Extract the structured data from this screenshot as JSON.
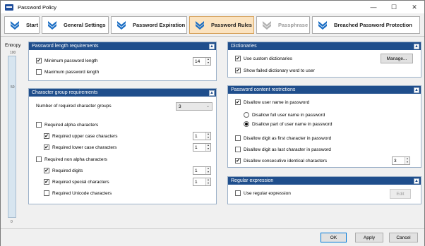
{
  "window": {
    "title": "Password Policy",
    "min_icon": "—",
    "max_icon": "☐",
    "close_icon": "✕"
  },
  "tabs": [
    {
      "label": "Start"
    },
    {
      "label": "General Settings"
    },
    {
      "label": "Password Expiration"
    },
    {
      "label": "Password Rules"
    },
    {
      "label": "Passphrase"
    },
    {
      "label": "Breached Password Protection"
    }
  ],
  "entropy": {
    "label": "Entropy",
    "tick_top": "100",
    "tick_mid": "50",
    "tick_bottom": "0"
  },
  "length_box": {
    "title": "Password length requirements",
    "min_label": "Minimum password length",
    "min_value": "14",
    "max_label": "Maximum password length"
  },
  "charset_box": {
    "title": "Character group requirements",
    "num_groups_label": "Number of required character groups",
    "num_groups_value": "3",
    "alpha_label": "Required alpha characters",
    "upper_label": "Required upper case characters",
    "upper_value": "1",
    "lower_label": "Required lower case characters",
    "lower_value": "1",
    "nonalpha_label": "Required non alpha characters",
    "digits_label": "Required digits",
    "digits_value": "1",
    "special_label": "Required special characters",
    "special_value": "1",
    "unicode_label": "Required Unicode characters"
  },
  "dict_box": {
    "title": "Dictionaries",
    "custom_label": "Use custom dictionaries",
    "manage_label": "Manage...",
    "show_failed_label": "Show failed dictionary word to user"
  },
  "content_box": {
    "title": "Password content restrictions",
    "disallow_user_label": "Disallow user name in password",
    "full_user_label": "Disallow full user name in password",
    "part_user_label": "Disallow part of user name in password",
    "digit_first_label": "Disallow digit as first character in password",
    "digit_last_label": "Disallow digit as last character in password",
    "consecutive_label": "Disallow consecutive identical characters",
    "consecutive_value": "3"
  },
  "regex_box": {
    "title": "Regular expression",
    "use_label": "Use regular expression",
    "edit_label": "Edit"
  },
  "footer": {
    "ok": "OK",
    "apply": "Apply",
    "cancel": "Cancel"
  },
  "icons": {
    "collapse": "▲",
    "check": "✔",
    "up": "▲",
    "down": "▼",
    "caret": "⌄"
  },
  "colors": {
    "accent": "#1f4e8c",
    "active_tab": "#fbe3c0",
    "chevron": "#1d6fc4"
  }
}
